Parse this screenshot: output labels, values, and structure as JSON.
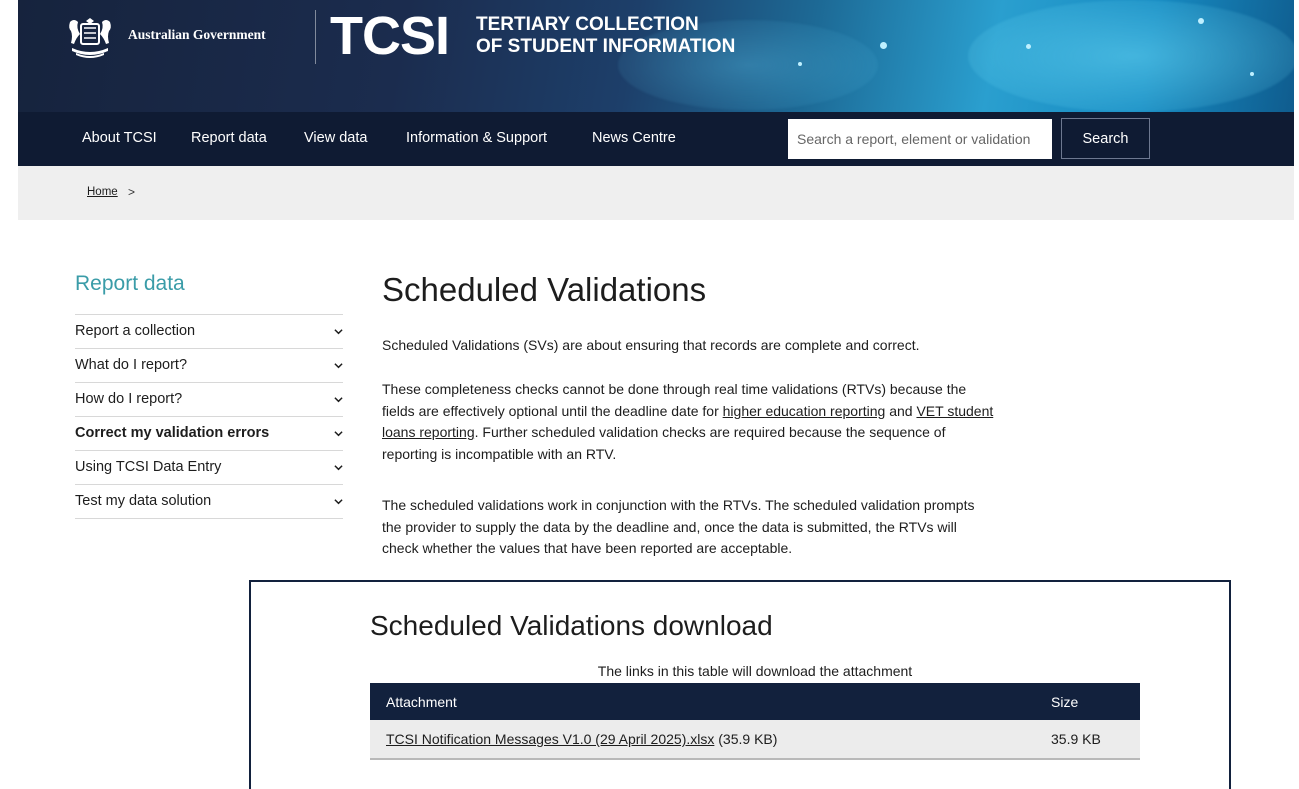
{
  "banner": {
    "gov_label": "Australian Government",
    "logo_text": "TCSI",
    "subtitle_line1": "TERTIARY COLLECTION",
    "subtitle_line2": "OF STUDENT INFORMATION"
  },
  "nav": {
    "items": [
      {
        "label": "About TCSI"
      },
      {
        "label": "Report data"
      },
      {
        "label": "View data"
      },
      {
        "label": "Information & Support"
      },
      {
        "label": "News Centre"
      }
    ],
    "search_placeholder": "Search a report, element or validation",
    "search_button": "Search"
  },
  "breadcrumb": {
    "home": "Home",
    "separator": ">"
  },
  "sidebar": {
    "title": "Report data",
    "items": [
      {
        "label": "Report a collection",
        "active": false
      },
      {
        "label": "What do I report?",
        "active": false
      },
      {
        "label": "How do I report?",
        "active": false
      },
      {
        "label": "Correct my validation errors",
        "active": true
      },
      {
        "label": "Using TCSI Data Entry",
        "active": false
      },
      {
        "label": "Test my data solution",
        "active": false
      }
    ]
  },
  "main": {
    "title": "Scheduled Validations",
    "p1": "Scheduled Validations (SVs) are about ensuring that records are complete and correct.",
    "p2_before": "These completeness checks cannot be done through real time validations (RTVs) because the fields are effectively optional until the deadline date for ",
    "p2_link1": "higher education reporting",
    "p2_mid": " and ",
    "p2_link2": "VET student loans reporting",
    "p2_after": ". Further scheduled validation checks are required because the sequence of reporting is incompatible with an RTV.",
    "p3": "The scheduled validations work in conjunction with the RTVs. The scheduled validation prompts the provider to supply the data by the deadline and, once the data is submitted, the RTVs will check whether the values that have been reported are acceptable."
  },
  "download": {
    "title": "Scheduled Validations download",
    "caption": "The links in this table will download the attachment",
    "headers": {
      "attachment": "Attachment",
      "size": "Size"
    },
    "rows": [
      {
        "link": "TCSI Notification Messages V1.0 (29 April 2025).xlsx",
        "suffix": " (35.9 KB)",
        "size": "35.9 KB"
      }
    ]
  },
  "colors": {
    "nav_bg": "#0f1b33",
    "accent_teal": "#3a9ca8",
    "breadcrumb_bg": "#efefef",
    "table_header": "#12213d"
  }
}
